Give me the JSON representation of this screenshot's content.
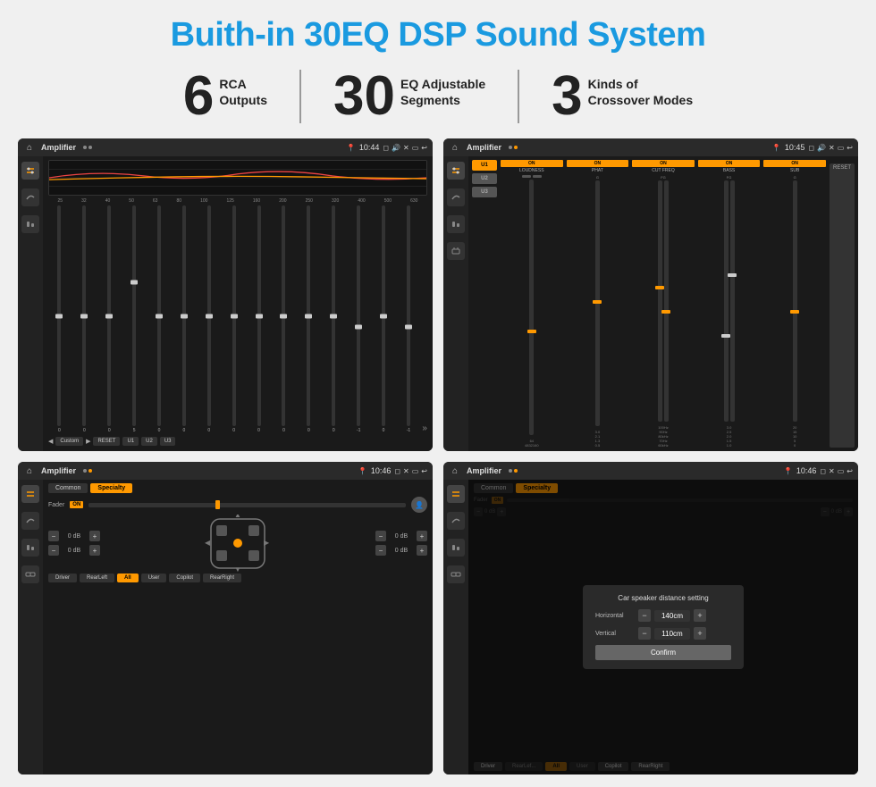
{
  "page": {
    "title": "Buith-in 30EQ DSP Sound System",
    "background_color": "#f0f0f0"
  },
  "stats": [
    {
      "number": "6",
      "label_line1": "RCA",
      "label_line2": "Outputs"
    },
    {
      "number": "30",
      "label_line1": "EQ Adjustable",
      "label_line2": "Segments"
    },
    {
      "number": "3",
      "label_line1": "Kinds of",
      "label_line2": "Crossover Modes"
    }
  ],
  "screens": [
    {
      "id": "eq-screen",
      "status_title": "Amplifier",
      "status_time": "10:44",
      "type": "equalizer",
      "freq_labels": [
        "25",
        "32",
        "40",
        "50",
        "63",
        "80",
        "100",
        "125",
        "160",
        "200",
        "250",
        "320",
        "400",
        "500",
        "630"
      ],
      "eq_values": [
        "0",
        "0",
        "0",
        "5",
        "0",
        "0",
        "0",
        "0",
        "0",
        "0",
        "0",
        "0",
        "-1",
        "0",
        "-1"
      ],
      "bottom_buttons": [
        "Custom",
        "RESET",
        "U1",
        "U2",
        "U3"
      ]
    },
    {
      "id": "dsp-screen",
      "status_title": "Amplifier",
      "status_time": "10:45",
      "type": "dsp",
      "presets": [
        "U1",
        "U2",
        "U3"
      ],
      "channels": [
        "LOUDNESS",
        "PHAT",
        "CUT FREQ",
        "BASS",
        "SUB"
      ],
      "reset_label": "RESET"
    },
    {
      "id": "fader-screen",
      "status_title": "Amplifier",
      "status_time": "10:46",
      "type": "fader",
      "tabs": [
        "Common",
        "Specialty"
      ],
      "active_tab": "Specialty",
      "fader_label": "Fader",
      "fader_on": "ON",
      "volumes": [
        "0 dB",
        "0 dB",
        "0 dB",
        "0 dB"
      ],
      "bottom_buttons": [
        "Driver",
        "RearLeft",
        "All",
        "User",
        "Copilot",
        "RearRight"
      ]
    },
    {
      "id": "dist-screen",
      "status_title": "Amplifier",
      "status_time": "10:46",
      "type": "distance",
      "tabs": [
        "Common",
        "Specialty"
      ],
      "modal": {
        "title": "Car speaker distance setting",
        "horizontal_label": "Horizontal",
        "horizontal_value": "140cm",
        "vertical_label": "Vertical",
        "vertical_value": "110cm",
        "confirm_label": "Confirm"
      },
      "volumes": [
        "0 dB",
        "0 dB"
      ],
      "bottom_buttons": [
        "Driver",
        "RearLeft",
        "All",
        "User",
        "Copilot",
        "RearRight"
      ]
    }
  ]
}
